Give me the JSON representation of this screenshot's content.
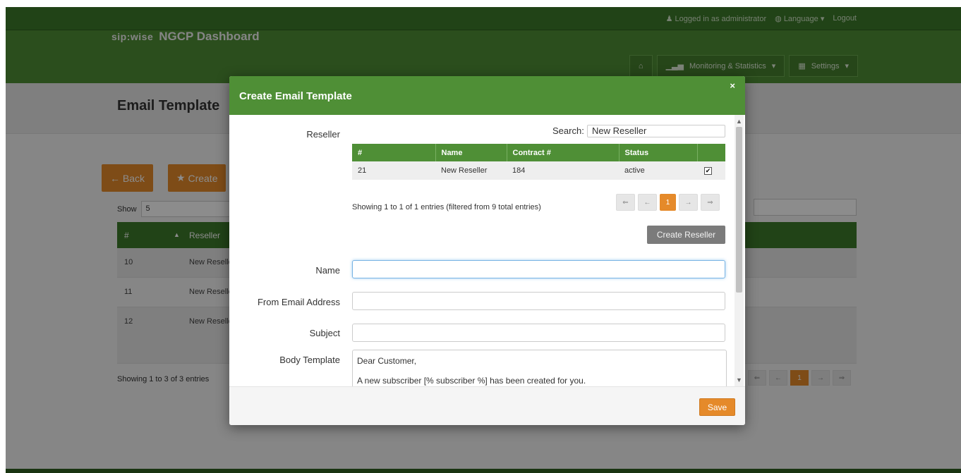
{
  "topbar": {
    "logged_in": "Logged in as administrator",
    "language": "Language",
    "logout": "Logout"
  },
  "brand": {
    "logo_text": "sip:wise",
    "title": "NGCP Dashboard"
  },
  "nav": {
    "monitoring": "Monitoring & Statistics",
    "settings": "Settings"
  },
  "page": {
    "title": "Email Template",
    "back_button": "Back",
    "create_button": "Create",
    "show_label": "Show",
    "show_value": "5",
    "table": {
      "headers": [
        "#",
        "Reseller"
      ],
      "rows": [
        {
          "id": "10",
          "reseller": "New Reselle"
        },
        {
          "id": "11",
          "reseller": "New Reselle"
        },
        {
          "id": "12",
          "reseller": "New Reselle"
        }
      ]
    },
    "footer_info": "Showing 1 to 3 of 3 entries",
    "pager_current": "1"
  },
  "modal": {
    "title": "Create Email Template",
    "close": "×",
    "reseller_label": "Reseller",
    "search_label": "Search:",
    "search_value": "New Reseller",
    "reseller_table": {
      "headers": [
        "#",
        "Name",
        "Contract #",
        "Status",
        ""
      ],
      "rows": [
        {
          "id": "21",
          "name": "New Reseller",
          "contract": "184",
          "status": "active",
          "checked": true
        }
      ]
    },
    "info": "Showing 1 to 1 of 1 entries (filtered from 9 total entries)",
    "pager": {
      "first": "⇐",
      "prev": "←",
      "current": "1",
      "next": "→",
      "last": "⇒"
    },
    "create_reseller": "Create Reseller",
    "fields": {
      "name_label": "Name",
      "name_value": "",
      "from_label": "From Email Address",
      "from_value": "",
      "subject_label": "Subject",
      "subject_value": "",
      "body_label": "Body Template",
      "body_value": "Dear Customer,\n\nA new subscriber [% subscriber %] has been created for you."
    },
    "save": "Save"
  },
  "colors": {
    "brand_green": "#4f8f36",
    "dark_green": "#3d7a2a",
    "accent_orange": "#e58a2a"
  }
}
